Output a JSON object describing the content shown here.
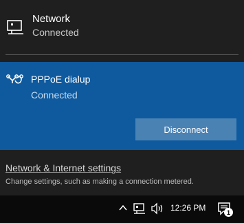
{
  "network": {
    "name": "Network",
    "status": "Connected",
    "icon": "wired-network-icon"
  },
  "dialup": {
    "name": "PPPoE dialup",
    "status": "Connected",
    "icon": "dialup-connection-icon",
    "button_label": "Disconnect"
  },
  "settings": {
    "link": "Network & Internet settings",
    "description": "Change settings, such as making a connection metered."
  },
  "taskbar": {
    "time": "12:26 PM",
    "notification_count": "1",
    "icons": [
      "chevron-up-icon",
      "network-icon",
      "volume-icon",
      "action-center-icon"
    ]
  },
  "colors": {
    "flyout_bg": "#1f1f1f",
    "accent": "#0f5a9e",
    "button_bg": "#4b82b4",
    "taskbar_bg": "#0a0a0a"
  }
}
